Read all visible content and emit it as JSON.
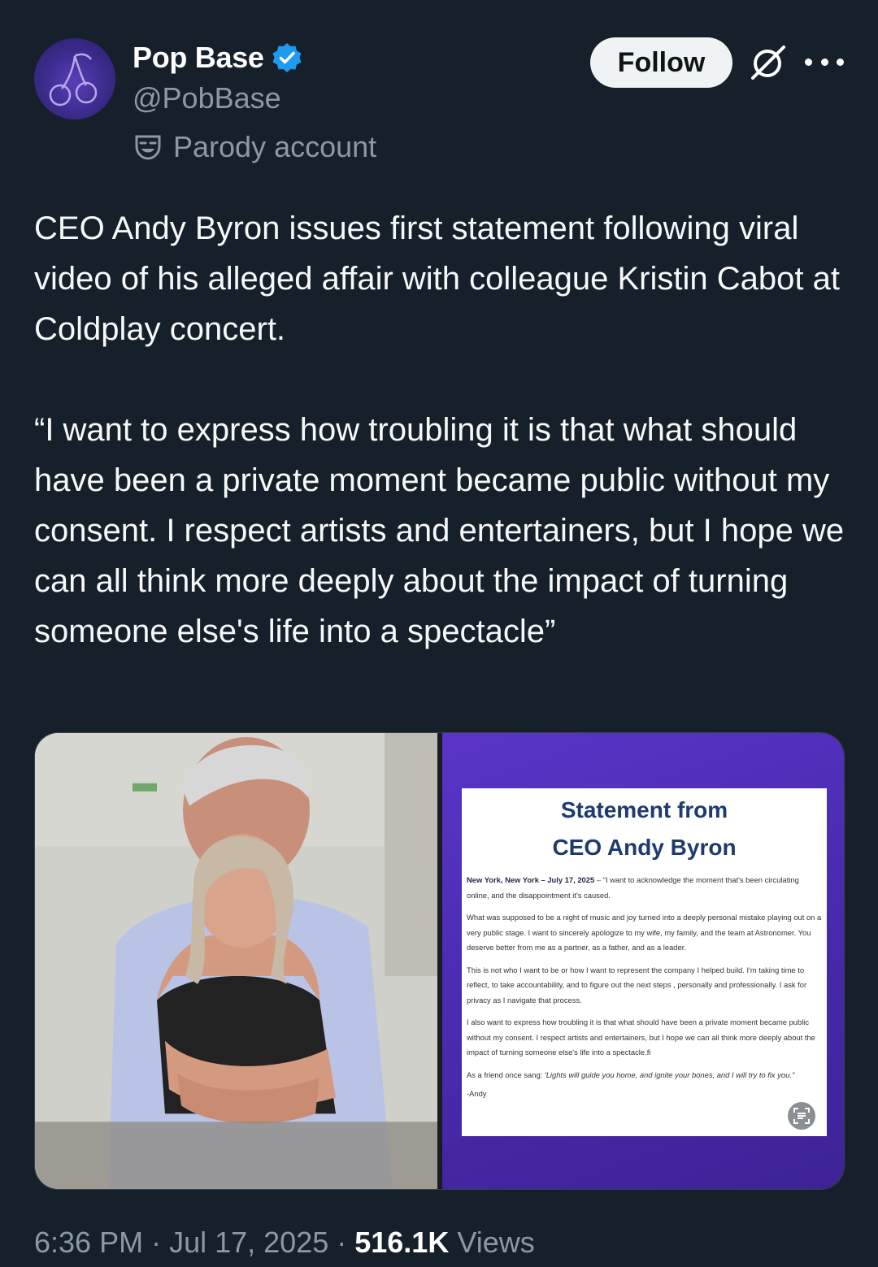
{
  "author": {
    "display_name": "Pop Base",
    "handle": "@PobBase",
    "verified": true,
    "label": "Parody account",
    "avatar_icon": "cherry-icon"
  },
  "actions": {
    "follow_label": "Follow",
    "grok_icon": "grok-icon",
    "more_icon": "more-options-icon"
  },
  "tweet": {
    "text": "CEO Andy Byron issues first statement following viral video of his alleged affair with colleague Kristin Cabot at Coldplay concert.\n\n“I want to express how troubling it is that what should have been a private moment became public without my consent. I respect artists and entertainers, but I hope we can all think more deeply about the impact of turning someone else's life into a spectacle”"
  },
  "media": {
    "statement": {
      "title_line1": "Statement from",
      "title_line2": "CEO Andy Byron",
      "dateline": "New York, New York – July 17, 2025",
      "p1_rest": " – \"I want to acknowledge the moment that's been circulating online, and the disappointment it's caused.",
      "p2": "What was supposed to be a night of music and joy turned into a deeply personal mistake playing out on a very public stage. I want to sincerely apologize to my wife, my family, and the team at Astronomer. You deserve better from me as a partner, as a father, and as a leader.",
      "p3": "This is not who I want to be or how I want to represent the company I helped build. I'm taking time to reflect, to take accountability, and to figure out the next steps , personally and professionally. I ask for privacy as I navigate that process.",
      "p4": "I also want to express how troubling it is that what should have been a private moment became public without my consent. I respect artists and entertainers, but I hope we can all think more deeply about the impact of turning someone else's life into a spectacle.fi",
      "p5_prefix": "As a friend once sang: ",
      "p5_quote": "'Lights will guide you home, and ignite your bones, and I will try to fix you.\"",
      "sign": "-Andy"
    },
    "colors": {
      "panel_purple": "#4a2aae",
      "title_blue": "#1e3a6e"
    }
  },
  "footer": {
    "time": "6:36 PM",
    "separator": " · ",
    "date": "Jul 17, 2025",
    "views_count": "516.1K",
    "views_label": " Views"
  },
  "colors": {
    "background": "#15202b",
    "secondary_text": "#8b98a5",
    "verified_blue": "#1d9bf0",
    "follow_bg": "#eff3f4"
  }
}
